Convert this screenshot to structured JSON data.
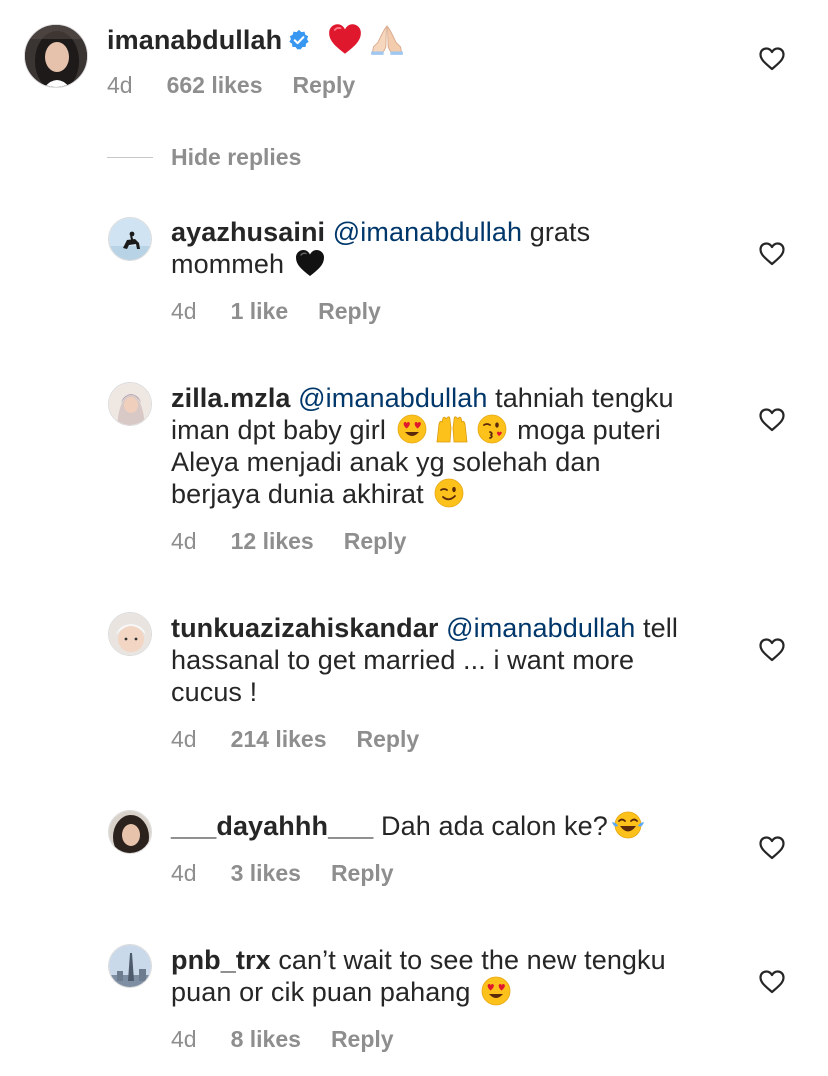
{
  "main_comment": {
    "username": "imanabdullah",
    "time": "4d",
    "likes": "662 likes",
    "reply": "Reply"
  },
  "hide_replies": "Hide replies",
  "replies": [
    {
      "username": "ayazhusaini",
      "mention": "@imanabdullah",
      "line1_rest": "grats",
      "line2": "mommeh",
      "time": "4d",
      "likes": "1 like",
      "reply": "Reply"
    },
    {
      "username": "zilla.mzla",
      "mention": "@imanabdullah",
      "line1_rest": "tahniah tengku",
      "line2a": "iman dpt baby girl",
      "line2b": "moga puteri",
      "line3": "Aleya menjadi anak yg solehah dan",
      "line4": "berjaya dunia akhirat",
      "time": "4d",
      "likes": "12 likes",
      "reply": "Reply"
    },
    {
      "username": "tunkuazizahiskandar",
      "mention": "@imanabdullah",
      "line1_rest": "tell",
      "line2": "hassanal to get married ... i want more",
      "line3": "cucus !",
      "time": "4d",
      "likes": "214 likes",
      "reply": "Reply"
    },
    {
      "username": "___dayahhh___",
      "text": "Dah ada calon ke?",
      "time": "4d",
      "likes": "3 likes",
      "reply": "Reply"
    },
    {
      "username": "pnb_trx",
      "text": "can’t wait to see the new tengku",
      "line2": "puan or cik puan pahang",
      "time": "4d",
      "likes": "8 likes",
      "reply": "Reply"
    }
  ],
  "colors": {
    "text": "#262626",
    "secondary": "#8e8e8e",
    "mention": "#00376b",
    "verified": "#3897f0"
  },
  "icons": [
    "verified-badge-icon",
    "heart-outline-icon",
    "red-heart-emoji",
    "folded-hands-emoji",
    "black-heart-emoji",
    "heart-eyes-emoji",
    "raised-hands-emoji",
    "kissing-wink-emoji",
    "winking-face-emoji",
    "tears-of-joy-emoji"
  ]
}
